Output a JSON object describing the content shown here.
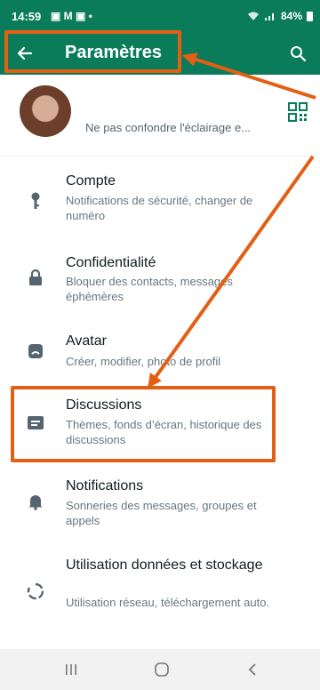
{
  "status_bar": {
    "time": "14:59",
    "left_icons": "▣ M ▣ •",
    "right_text": "84%"
  },
  "app_bar": {
    "title": "Paramètres"
  },
  "profile": {
    "status": "Ne pas confondre l'éclairage e..."
  },
  "settings": [
    {
      "title": "Compte",
      "subtitle": "Notifications de sécurité, changer de numéro",
      "icon": "key-icon"
    },
    {
      "title": "Confidentialité",
      "subtitle": "Bloquer des contacts, messages éphémères",
      "icon": "lock-icon"
    },
    {
      "title": "Avatar",
      "subtitle": "Créer, modifier, photo de profil",
      "icon": "avatar-icon"
    },
    {
      "title": "Discussions",
      "subtitle": "Thèmes, fonds d’écran, historique des discussions",
      "icon": "chat-icon"
    },
    {
      "title": "Notifications",
      "subtitle": "Sonneries des messages, groupes et appels",
      "icon": "bell-icon"
    },
    {
      "title": "Utilisation données et stockage",
      "subtitle": "Utilisation réseau, téléchargement auto.",
      "icon": "storage-icon"
    }
  ],
  "colors": {
    "brand": "#0a7c5a",
    "annotation": "#e35f14",
    "icon": "#54656f"
  }
}
